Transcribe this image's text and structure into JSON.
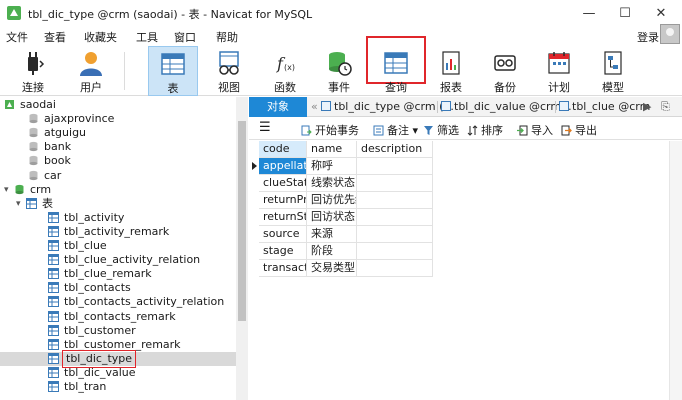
{
  "window": {
    "title": "tbl_dic_type @crm (saodai) - 表 - Navicat for MySQL",
    "minimize": "—",
    "maximize": "☐",
    "close": "✕"
  },
  "menu": {
    "items": [
      "文件",
      "查看",
      "收藏夹",
      "工具",
      "窗口",
      "帮助"
    ],
    "login": "登录"
  },
  "toolbar": {
    "connect": "连接",
    "user": "用户",
    "table": "表",
    "view": "视图",
    "function": "函数",
    "event": "事件",
    "query": "查询",
    "report": "报表",
    "backup": "备份",
    "schedule": "计划",
    "model": "模型"
  },
  "tree": {
    "connection": "saodai",
    "items": [
      "ajaxprovince",
      "atguigu",
      "bank",
      "book",
      "car"
    ],
    "database": "crm",
    "tables_node": "表",
    "tables": [
      "tbl_activity",
      "tbl_activity_remark",
      "tbl_clue",
      "tbl_clue_activity_relation",
      "tbl_clue_remark",
      "tbl_contacts",
      "tbl_contacts_activity_relation",
      "tbl_contacts_remark",
      "tbl_customer",
      "tbl_customer_remark",
      "tbl_dic_type",
      "tbl_dic_value",
      "tbl_tran"
    ],
    "selected": "tbl_dic_type"
  },
  "tabs": {
    "objects": "对象",
    "items": [
      "tbl_dic_type @crm (...",
      "tbl_dic_value @crm...",
      "tbl_clue @crm"
    ]
  },
  "subtoolbar": {
    "begin_transaction": "开始事务",
    "memo": "备注",
    "filter": "筛选",
    "sort": "排序",
    "import": "导入",
    "export": "导出"
  },
  "grid": {
    "columns": [
      "code",
      "name",
      "description"
    ],
    "rows": [
      [
        "appellation",
        "称呼",
        ""
      ],
      [
        "clueState",
        "线索状态",
        ""
      ],
      [
        "returnPriority",
        "回访优先级",
        ""
      ],
      [
        "returnState",
        "回访状态",
        ""
      ],
      [
        "source",
        "来源",
        ""
      ],
      [
        "stage",
        "阶段",
        ""
      ],
      [
        "transactionType",
        "交易类型",
        ""
      ]
    ]
  }
}
